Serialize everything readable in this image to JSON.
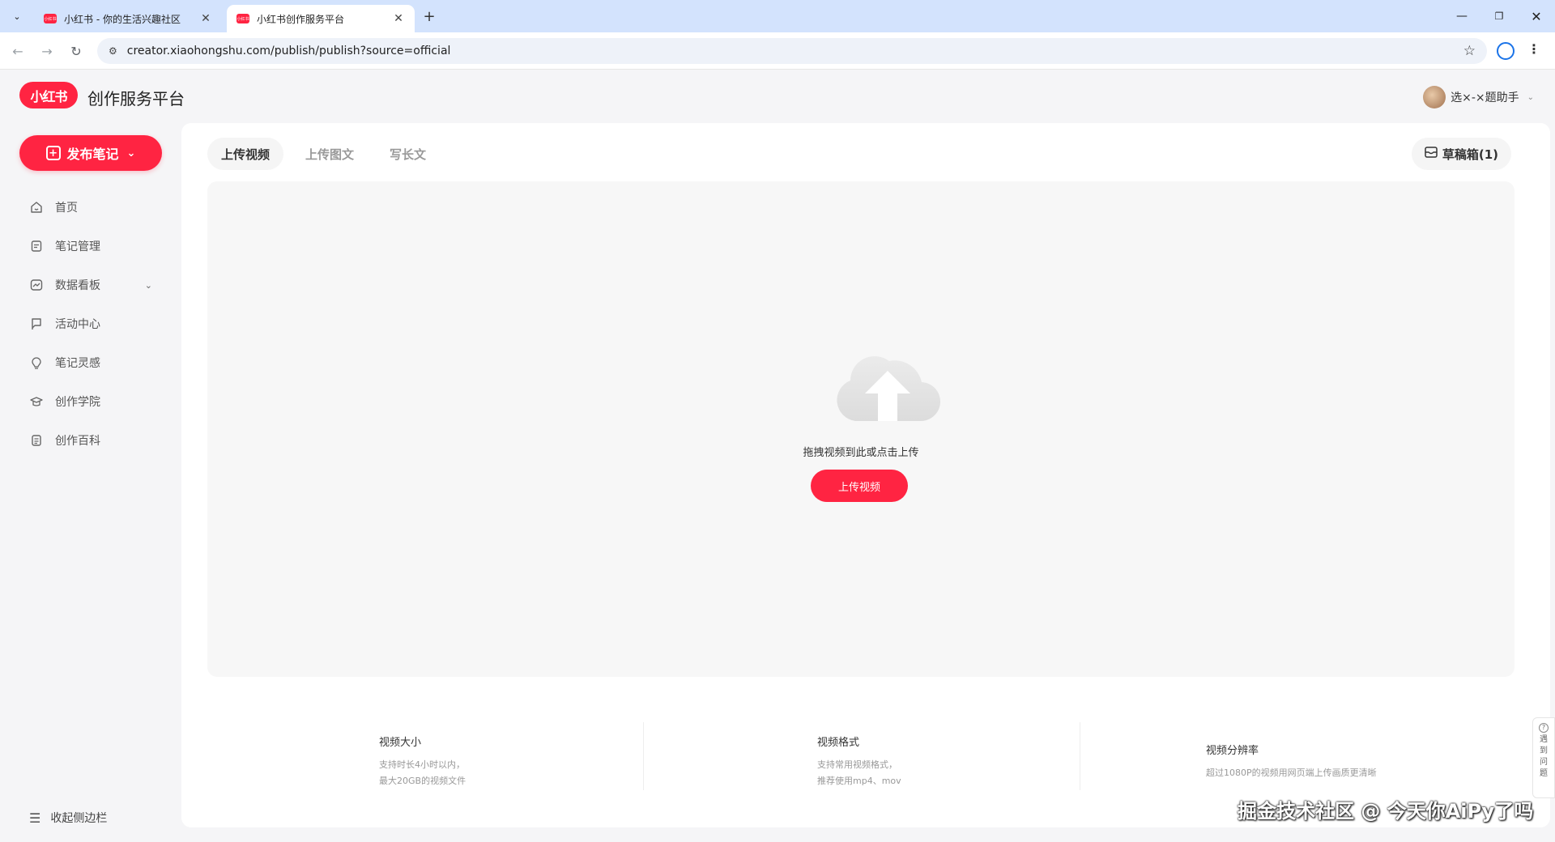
{
  "browser": {
    "tabs": [
      {
        "title": "小红书 - 你的生活兴趣社区",
        "favicon": "xhs-favicon"
      },
      {
        "title": "小红书创作服务平台",
        "favicon": "xhs-favicon"
      }
    ],
    "url": "creator.xiaohongshu.com/publish/publish?source=official",
    "favicon_text": "小红书"
  },
  "header": {
    "logo": "小红书",
    "title": "创作服务平台",
    "user_name": "选×-×题助手"
  },
  "sidebar": {
    "publish_label": "发布笔记",
    "items": [
      {
        "label": "首页",
        "icon": "home-icon"
      },
      {
        "label": "笔记管理",
        "icon": "note-icon"
      },
      {
        "label": "数据看板",
        "icon": "chart-icon"
      },
      {
        "label": "活动中心",
        "icon": "flag-icon"
      },
      {
        "label": "笔记灵感",
        "icon": "bulb-icon"
      },
      {
        "label": "创作学院",
        "icon": "graduation-icon"
      },
      {
        "label": "创作百科",
        "icon": "book-icon"
      }
    ],
    "collapse_label": "收起侧边栏"
  },
  "main": {
    "tabs": [
      {
        "label": "上传视频",
        "active": true
      },
      {
        "label": "上传图文",
        "active": false
      },
      {
        "label": "写长文",
        "active": false
      }
    ],
    "drafts_label": "草稿箱(1)",
    "upload_hint": "拖拽视频到此或点击上传",
    "upload_button": "上传视频",
    "specs": [
      {
        "title": "视频大小",
        "lines": [
          "支持时长4小时以内，",
          "最大20GB的视频文件"
        ]
      },
      {
        "title": "视频格式",
        "lines": [
          "支持常用视频格式，",
          "推荐使用mp4、mov"
        ]
      },
      {
        "title": "视频分辨率",
        "lines": [
          "超过1080P的视频用网页端上传画质更清晰"
        ]
      }
    ]
  },
  "help_label": [
    "遇",
    "到",
    "问",
    "题"
  ],
  "watermark": "掘金技术社区 @ 今天你AiPy了吗",
  "colors": {
    "brand": "#ff2442",
    "background": "#f5f5f7"
  }
}
